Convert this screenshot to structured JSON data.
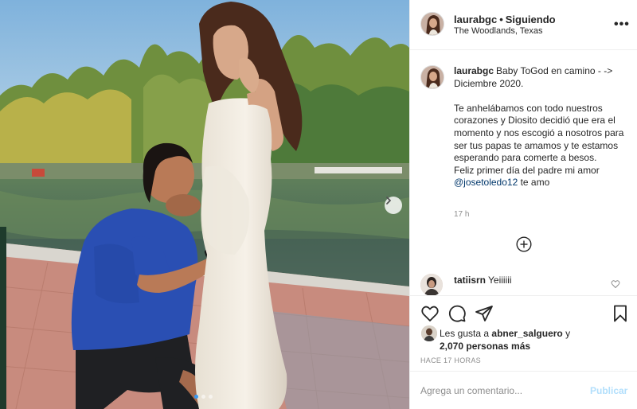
{
  "header": {
    "username": "laurabgc",
    "separator": "•",
    "follow_status": "Siguiendo",
    "location": "The Woodlands, Texas",
    "more_icon": "more-horizontal-icon",
    "more_label": "•••"
  },
  "caption": {
    "username": "laurabgc",
    "line1": "Baby ToGod en camino - -> Diciembre 2020.",
    "line2": "Te anhelábamos con todo nuestros corazones y Diosito decidió que era el momento y nos escogió a nosotros para ser tus papas te amamos y te estamos esperando para comerte a besos.",
    "line3": "Feliz primer día del padre mi amor",
    "mention": "@josetoledo12",
    "line3_end": "te amo",
    "time": "17 h"
  },
  "load_more_icon": "plus-circle-icon",
  "comments": [
    {
      "username": "tatiisrn",
      "text": "Yeiiiiii",
      "like_icon": "heart-outline-icon"
    }
  ],
  "actions": {
    "like_icon": "heart-outline-icon",
    "comment_icon": "comment-bubble-icon",
    "share_icon": "paper-plane-icon",
    "save_icon": "bookmark-icon"
  },
  "likes": {
    "prefix": "Les gusta a",
    "user": "abner_salguero",
    "conjunction": "y",
    "count_text": "2,070 personas más"
  },
  "post_date": "HACE 17 HORAS",
  "add_comment": {
    "placeholder": "Agrega un comentario...",
    "publish_label": "Publicar"
  },
  "carousel": {
    "slide_count": 3,
    "active_index": 0,
    "next_icon": "chevron-right-icon"
  },
  "colors": {
    "link": "#00376b",
    "publish_disabled": "#b2dffc",
    "secondary_text": "#8e8e8e",
    "active_dot": "#3897f0",
    "shirt": "#2a4fb3"
  }
}
